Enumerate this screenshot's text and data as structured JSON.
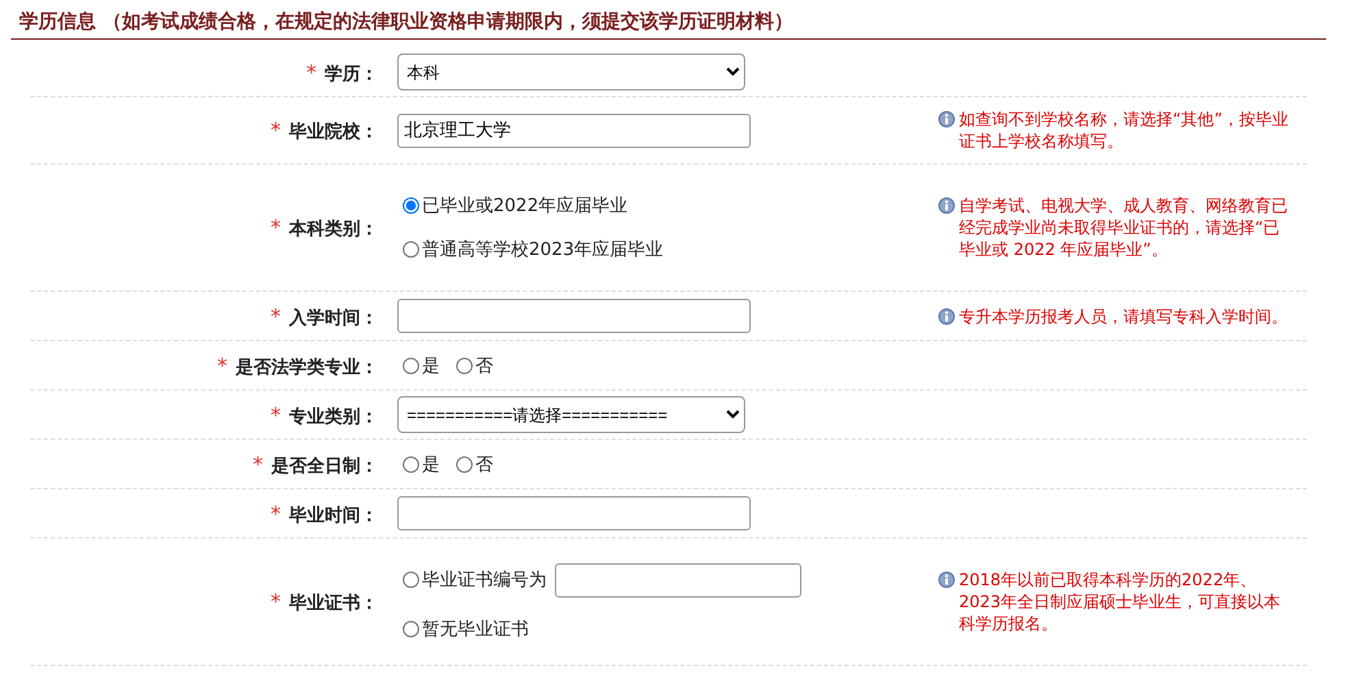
{
  "section": {
    "title": "学历信息 （如考试成绩合格，在规定的法律职业资格申请期限内，须提交该学历证明材料）"
  },
  "rows": [
    {
      "label": "学历：",
      "required_mark": "*",
      "kind": "select",
      "value": "本科"
    },
    {
      "label": "毕业院校：",
      "required_mark": "*",
      "kind": "text",
      "value": "北京理工大学",
      "hint": "如查询不到学校名称，请选择“其他”，按毕业证书上学校名称填写。"
    },
    {
      "label": "本科类别：",
      "required_mark": "*",
      "kind": "radio",
      "stacked": true,
      "options": [
        {
          "label": "已毕业或2022年应届毕业",
          "selected": true
        },
        {
          "label": "普通高等学校2023年应届毕业",
          "selected": false
        }
      ],
      "hint": "自学考试、电视大学、成人教育、网络教育已经完成学业尚未取得毕业证书的，请选择“已毕业或 2022 年应届毕业”。"
    },
    {
      "label": "入学时间：",
      "required_mark": "*",
      "kind": "text",
      "hint": "专升本学历报考人员，请填写专科入学时间。"
    },
    {
      "label": "是否法学类专业：",
      "required_mark": "*",
      "kind": "radio",
      "stacked": false,
      "options": [
        {
          "label": "是",
          "selected": false
        },
        {
          "label": "否",
          "selected": false
        }
      ]
    },
    {
      "label": "专业类别：",
      "required_mark": "*",
      "kind": "select",
      "value": "===========请选择==========="
    },
    {
      "label": "是否全日制：",
      "required_mark": "*",
      "kind": "radio",
      "stacked": false,
      "options": [
        {
          "label": "是",
          "selected": false
        },
        {
          "label": "否",
          "selected": false
        }
      ]
    },
    {
      "label": "毕业时间：",
      "required_mark": "*",
      "kind": "text"
    },
    {
      "label": "毕业证书：",
      "required_mark": "*",
      "kind": "radio",
      "stacked": true,
      "options": [
        {
          "label": "毕业证书编号为",
          "selected": false,
          "with_input": true
        },
        {
          "label": "暂无毕业证书",
          "selected": false
        }
      ],
      "hint": "2018年以前已取得本科学历的2022年、2023年全日制应届硕士毕业生，可直接以本科学历报名。"
    }
  ]
}
